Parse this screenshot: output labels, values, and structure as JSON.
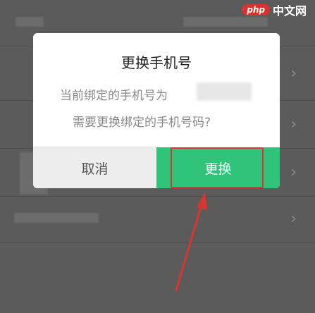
{
  "watermark": {
    "logo": "php",
    "text": "中文网"
  },
  "dialog": {
    "title": "更换手机号",
    "line1": "当前绑定的手机号为",
    "line2": "需要更换绑定的手机号码?",
    "cancel_label": "取消",
    "change_label": "更换"
  },
  "background": {
    "chevron": "›"
  },
  "colors": {
    "accent": "#2fc47a",
    "highlight": "#d9362f",
    "overlay": "#5b5b5b"
  }
}
